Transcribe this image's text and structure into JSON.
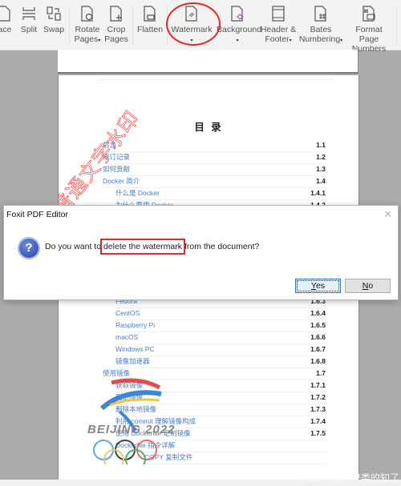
{
  "toolbar": {
    "items": [
      {
        "label": "ace",
        "icon": "replace-page-icon",
        "has_dropdown": false
      },
      {
        "label": "Split",
        "icon": "split-icon",
        "has_dropdown": false
      },
      {
        "label": "Swap",
        "icon": "swap-icon",
        "has_dropdown": false
      },
      {
        "label": "Rotate",
        "label2": "Pages",
        "icon": "rotate-pages-icon",
        "has_dropdown": true
      },
      {
        "label": "Crop",
        "label2": "Pages",
        "icon": "crop-pages-icon",
        "has_dropdown": false
      },
      {
        "label": "Flatten",
        "icon": "flatten-icon",
        "has_dropdown": false
      },
      {
        "label": "Watermark",
        "icon": "watermark-icon",
        "has_dropdown": true
      },
      {
        "label": "Background",
        "icon": "background-icon",
        "has_dropdown": true
      },
      {
        "label": "Header &",
        "label2": "Footer",
        "icon": "header-footer-icon",
        "has_dropdown": true
      },
      {
        "label": "Bates",
        "label2": "Numbering",
        "icon": "bates-numbering-icon",
        "has_dropdown": true
      },
      {
        "label": "Format Page",
        "label2": "Numbers",
        "icon": "format-page-numbers-icon",
        "has_dropdown": false
      }
    ],
    "caret": "▾",
    "highlight_color": "#e8262a"
  },
  "document": {
    "toc_title": "目 录",
    "watermark_text": "普通文字水印",
    "logo_text": "BEIJING 2022",
    "toc": [
      {
        "label": "前言",
        "num": "1.1",
        "indent": 0
      },
      {
        "label": "修订记录",
        "num": "1.2",
        "indent": 0
      },
      {
        "label": "如何贡献",
        "num": "1.3",
        "indent": 0
      },
      {
        "label": "Docker 简介",
        "num": "1.4",
        "indent": 0
      },
      {
        "label": "什么是 Docker",
        "num": "1.4.1",
        "indent": 1
      },
      {
        "label": "为什么要用 Docker",
        "num": "1.4.2",
        "indent": 1
      },
      {
        "label": "Fedora",
        "num": "1.6.3",
        "indent": 1
      },
      {
        "label": "CentOS",
        "num": "1.6.4",
        "indent": 1
      },
      {
        "label": "Raspberry Pi",
        "num": "1.6.5",
        "indent": 1
      },
      {
        "label": "macOS",
        "num": "1.6.6",
        "indent": 1
      },
      {
        "label": "Windows PC",
        "num": "1.6.7",
        "indent": 1
      },
      {
        "label": "镜像加速器",
        "num": "1.6.8",
        "indent": 1
      },
      {
        "label": "使用镜像",
        "num": "1.7",
        "indent": 0
      },
      {
        "label": "获取镜像",
        "num": "1.7.1",
        "indent": 1
      },
      {
        "label": "列出镜像",
        "num": "1.7.2",
        "indent": 1
      },
      {
        "label": "删除本地镜像",
        "num": "1.7.3",
        "indent": 1
      },
      {
        "label": "利用 commit 理解镜像构成",
        "num": "1.7.4",
        "indent": 1
      },
      {
        "label": "使用 Dockerfile 定制镜像",
        "num": "1.7.5",
        "indent": 1
      },
      {
        "label": "Dockerfile 指令详解",
        "num": "",
        "indent": 1
      },
      {
        "label": "COPY 复制文件",
        "num": "",
        "indent": 2
      }
    ]
  },
  "dialog": {
    "title": "Foxit PDF Editor",
    "close_glyph": "✕",
    "icon_glyph": "?",
    "message_pre": "Do you want to ",
    "message_highlight": "delete the watermark",
    "message_post": " from the document?",
    "yes_label_accel": "Y",
    "yes_label_rest": "es",
    "no_label_accel": "N",
    "no_label_rest": "o"
  },
  "credit": "CSDN @一只类的知了"
}
